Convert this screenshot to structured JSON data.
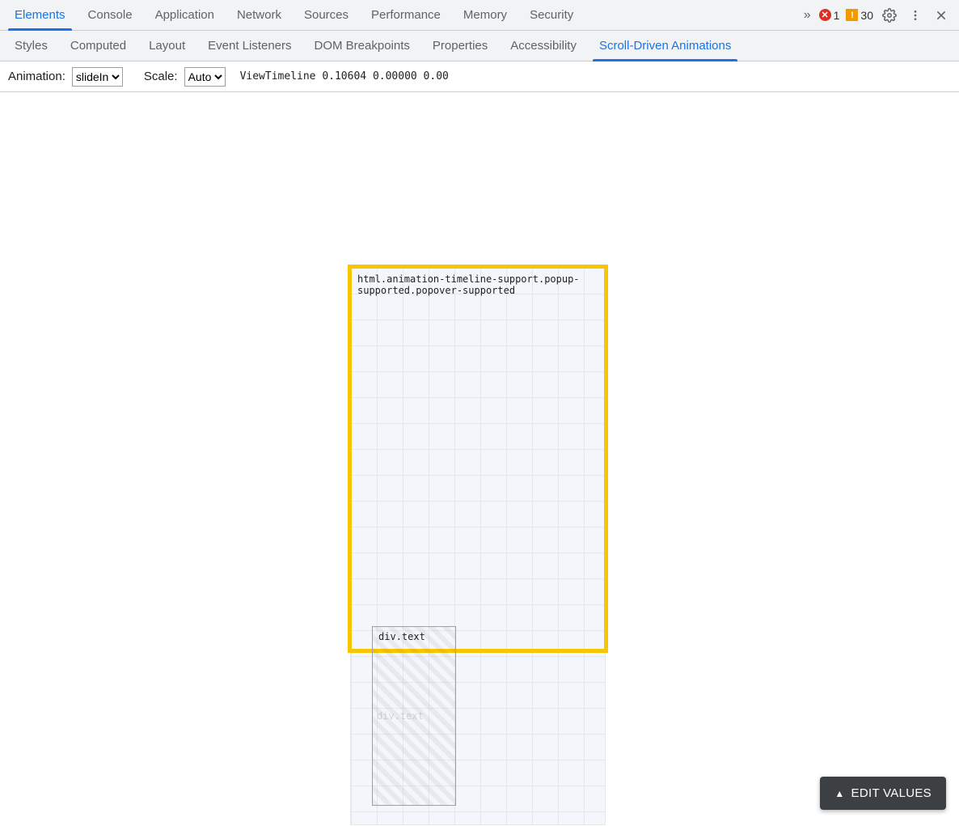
{
  "mainTabs": {
    "items": [
      "Elements",
      "Console",
      "Application",
      "Network",
      "Sources",
      "Performance",
      "Memory",
      "Security"
    ],
    "activeIndex": 0
  },
  "topRight": {
    "moreGlyph": "»",
    "errorCount": "1",
    "warnCount": "30"
  },
  "subTabs": {
    "items": [
      "Styles",
      "Computed",
      "Layout",
      "Event Listeners",
      "DOM Breakpoints",
      "Properties",
      "Accessibility",
      "Scroll-Driven Animations"
    ],
    "activeIndex": 7
  },
  "toolbar": {
    "animationLabel": "Animation:",
    "animationValue": "slideIn",
    "scaleLabel": "Scale:",
    "scaleValue": "Auto",
    "timelineText": "ViewTimeline 0.10604 0.00000 0.00"
  },
  "viz": {
    "rootNodeLabel": "html.animation-timeline-support.popup-supported.popover-supported",
    "childNodeLabel": "div.text",
    "ghostNodeLabel": "div.text"
  },
  "editValues": {
    "label": "EDIT VALUES"
  }
}
